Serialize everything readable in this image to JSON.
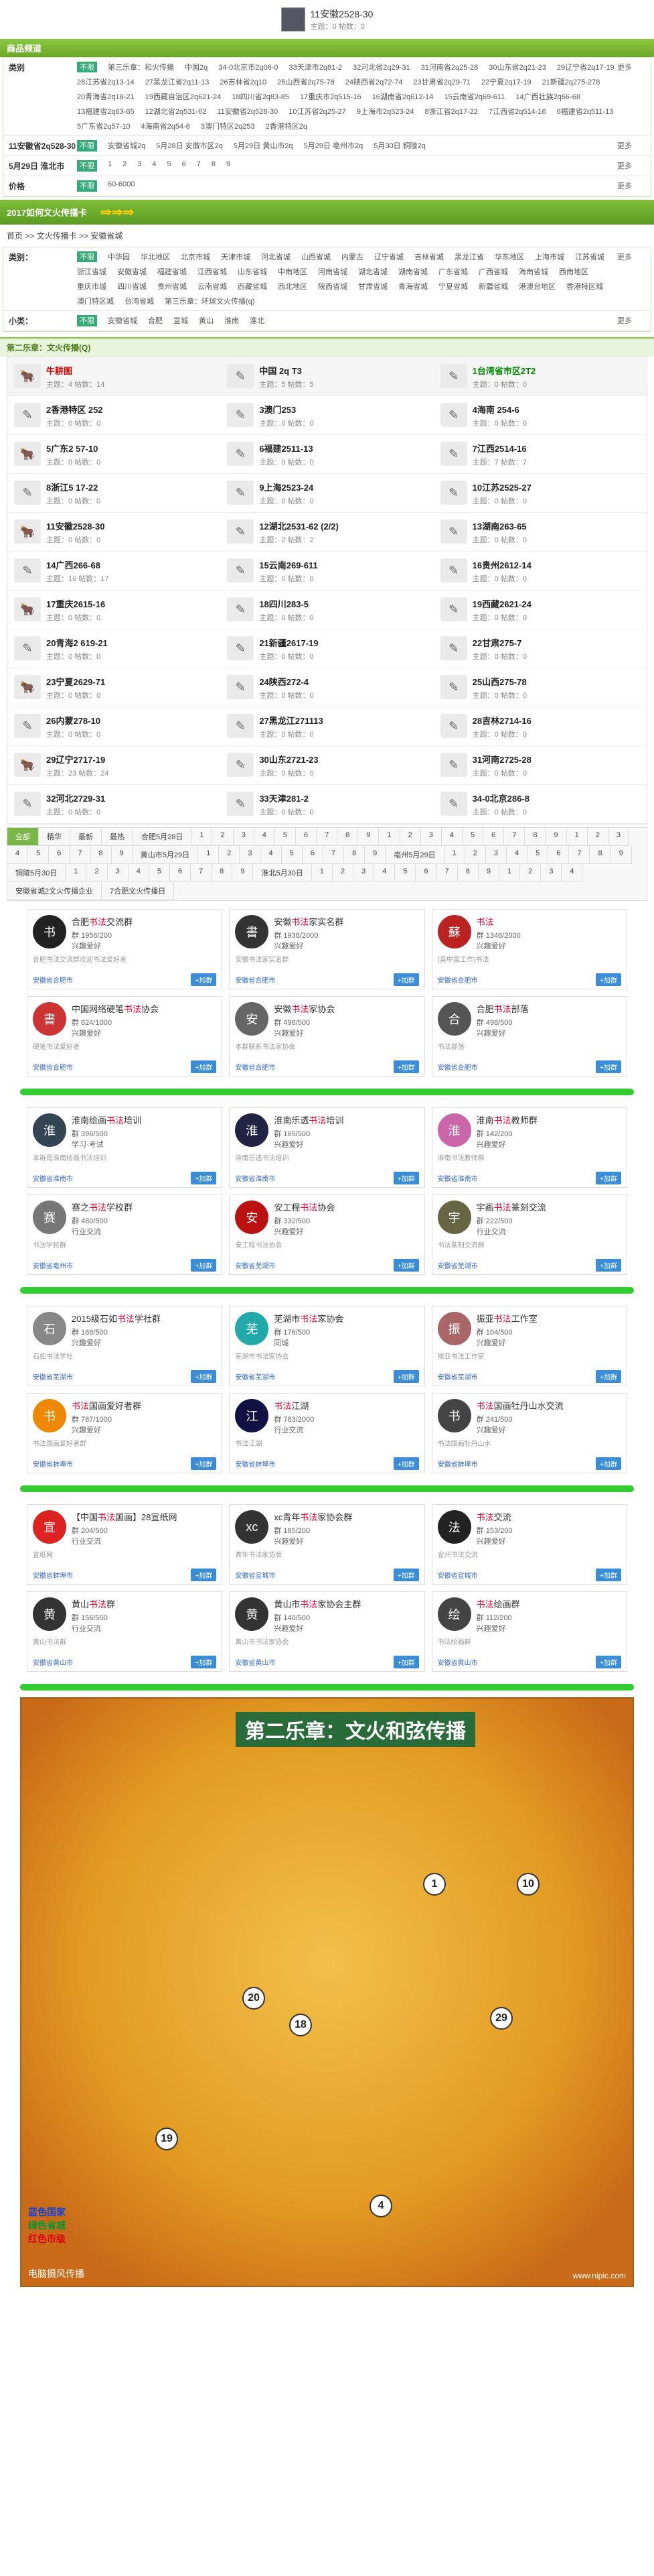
{
  "top": {
    "title": "11安徽2528-30",
    "sub": "主题：0 帖数：0"
  },
  "nav": {
    "title": "商品频道"
  },
  "filters": [
    {
      "label": "类别",
      "opts": [
        "不限",
        "第三乐章：和火传播",
        "中国2q",
        "34-0北京市2q06-0",
        "33天津市2q81-2",
        "32河北省2q29-31",
        "31河南省2q25-28",
        "30山东省2q21-23",
        "29辽宁省2q17-19",
        "28江苏省2q13-14",
        "27黑龙江省2q11-13",
        "26吉林省2q10",
        "25山西省2q75-78",
        "24陕西省2q72-74",
        "23甘肃省2q29-71",
        "22宁夏2q17-19",
        "21新疆2q275-278",
        "20青海省2q18-21",
        "19西藏自治区2q621-24",
        "18四川省2q83-85",
        "17重庆市2q515-16",
        "16湖南省2q612-14",
        "15云南省2q69-611",
        "14广西壮族2q66-68",
        "13福建省2q63-65",
        "12湖北省2q531-62",
        "11安徽省2q528-30",
        "10江苏省2q25-27",
        "9上海市2q523-24",
        "8浙江省2q17-22",
        "7江西省2q514-16",
        "6福建省2q511-13",
        "5广东省2q57-10",
        "4海南省2q54-6",
        "3澳门特区2q253",
        "2香港特区2q"
      ],
      "more": "更多"
    },
    {
      "label": "11安徽省2q528-30",
      "opts": [
        "不限",
        "安徽省城2q",
        "5月28日 安徽市区2q",
        "5月29日 黄山市2q",
        "5月29日 亳州市2q",
        "5月30日 铜陵2q"
      ],
      "more": "更多"
    },
    {
      "label": "5月29日 淮北市",
      "opts": [
        "不限",
        "1",
        "2",
        "3",
        "4",
        "5",
        "6",
        "7",
        "8",
        "9"
      ],
      "more": "更多"
    },
    {
      "label": "价格",
      "opts": [
        "不限",
        "60-6000"
      ],
      "more": "更多"
    }
  ],
  "crumbbar": {
    "title": "2017如何文火传播卡",
    "arrow": "⇒⇒⇒"
  },
  "crumb": [
    "首页",
    "文火传播卡",
    "安徽省城"
  ],
  "region": {
    "label": "类别：",
    "opts": [
      "不限",
      "中华园",
      "华北地区",
      "北京市城",
      "天津市城",
      "河北省城",
      "山西省城",
      "内蒙古",
      "辽宁省城",
      "吉林省城",
      "黑龙江省",
      "华东地区",
      "上海市城",
      "江苏省城",
      "浙江省城",
      "安徽省城",
      "福建省城",
      "江西省城",
      "山东省城",
      "中南地区",
      "河南省城",
      "湖北省城",
      "湖南省城",
      "广东省城",
      "广西省城",
      "海南省城",
      "西南地区",
      "重庆市城",
      "四川省城",
      "贵州省城",
      "云南省城",
      "西藏省城",
      "西北地区",
      "陕西省城",
      "甘肃省城",
      "青海省城",
      "宁夏省城",
      "新疆省城",
      "港澳台地区",
      "香港特区城",
      "澳门特区城",
      "台湾省城",
      "第三乐章：环球文火传播(q)"
    ],
    "more": "更多"
  },
  "subclass": {
    "label": "小类：",
    "opts": [
      "不限",
      "安徽省城",
      "合肥",
      "宣城",
      "黄山",
      "淮南",
      "淮北"
    ],
    "more": "更多"
  },
  "forum": {
    "head": "第二乐章：文火传播(Q)",
    "items": [
      {
        "name": "牛耕图",
        "meta": "主题：4 帖数：14",
        "hl": true,
        "cls": "red"
      },
      {
        "name": "中国 2q T3",
        "meta": "主题：5 帖数：5",
        "hl": true,
        "cls": ""
      },
      {
        "name": "1台湾省市区2T2",
        "meta": "主题：0 帖数：0",
        "hl": true,
        "cls": "gr"
      },
      {
        "name": "2香港特区 252",
        "meta": "主题：0 帖数：0",
        "cls": ""
      },
      {
        "name": "3澳门253",
        "meta": "主题：0 帖数：0",
        "cls": ""
      },
      {
        "name": "4海南 254-6",
        "meta": "主题：0 帖数：0",
        "cls": ""
      },
      {
        "name": "5广东2 57-10",
        "meta": "主题：0 帖数：0",
        "cls": ""
      },
      {
        "name": "6福建2511-13",
        "meta": "主题：0 帖数：0",
        "cls": ""
      },
      {
        "name": "7江西2514-16",
        "meta": "主题：7 帖数：7",
        "cls": ""
      },
      {
        "name": "8浙江5 17-22",
        "meta": "主题：0 帖数：0",
        "cls": ""
      },
      {
        "name": "9上海2523-24",
        "meta": "主题：0 帖数：0",
        "cls": ""
      },
      {
        "name": "10江苏2525-27",
        "meta": "主题：0 帖数：0",
        "cls": ""
      },
      {
        "name": "11安徽2528-30",
        "meta": "主题：0 帖数：0",
        "cls": ""
      },
      {
        "name": "12湖北2531-62 (2/2)",
        "meta": "主题：2 帖数：2",
        "cls": ""
      },
      {
        "name": "13湖南263-65",
        "meta": "主题：0 帖数：0",
        "cls": ""
      },
      {
        "name": "14广西266-68",
        "meta": "主题：16 帖数：17",
        "cls": ""
      },
      {
        "name": "15云南269-611",
        "meta": "主题：0 帖数：0",
        "cls": ""
      },
      {
        "name": "16贵州2612-14",
        "meta": "主题：0 帖数：0",
        "cls": ""
      },
      {
        "name": "17重庆2615-16",
        "meta": "主题：0 帖数：0",
        "cls": ""
      },
      {
        "name": "18四川283-5",
        "meta": "主题：0 帖数：0",
        "cls": ""
      },
      {
        "name": "19西藏2621-24",
        "meta": "主题：0 帖数：0",
        "cls": ""
      },
      {
        "name": "20青海2 619-21",
        "meta": "主题：0 帖数：0",
        "cls": ""
      },
      {
        "name": "21新疆2617-19",
        "meta": "主题：0 帖数：0",
        "cls": ""
      },
      {
        "name": "22甘肃275-7",
        "meta": "主题：0 帖数：0",
        "cls": ""
      },
      {
        "name": "23宁夏2629-71",
        "meta": "主题：0 帖数：0",
        "cls": ""
      },
      {
        "name": "24陕西272-4",
        "meta": "主题：0 帖数：0",
        "cls": ""
      },
      {
        "name": "25山西275-78",
        "meta": "主题：0 帖数：0",
        "cls": ""
      },
      {
        "name": "26内蒙278-10",
        "meta": "主题：0 帖数：0",
        "cls": ""
      },
      {
        "name": "27黑龙江271113",
        "meta": "主题：0 帖数：0",
        "cls": ""
      },
      {
        "name": "28吉林2714-16",
        "meta": "主题：0 帖数：0",
        "cls": ""
      },
      {
        "name": "29辽宁2717-19",
        "meta": "主题：23 帖数：24",
        "cls": ""
      },
      {
        "name": "30山东2721-23",
        "meta": "主题：0 帖数：0",
        "cls": ""
      },
      {
        "name": "31河南2725-28",
        "meta": "主题：0 帖数：0",
        "cls": ""
      },
      {
        "name": "32河北2729-31",
        "meta": "主题：0 帖数：0",
        "cls": ""
      },
      {
        "name": "33天津281-2",
        "meta": "主题：0 帖数：0",
        "cls": ""
      },
      {
        "name": "34-0北京286-8",
        "meta": "主题：0 帖数：0",
        "cls": ""
      }
    ]
  },
  "tags": [
    "全部",
    "精华",
    "最新",
    "最热",
    "合肥5月28日",
    "1",
    "2",
    "3",
    "4",
    "5",
    "6",
    "7",
    "8",
    "9",
    "1",
    "2",
    "3",
    "4",
    "5",
    "6",
    "7",
    "8",
    "9",
    "1",
    "2",
    "3",
    "4",
    "5",
    "6",
    "7",
    "8",
    "9",
    "黄山市5月29日",
    "1",
    "2",
    "3",
    "4",
    "5",
    "6",
    "7",
    "8",
    "9",
    "亳州5月29日",
    "1",
    "2",
    "3",
    "4",
    "5",
    "6",
    "7",
    "8",
    "9",
    "铜陵5月30日",
    "1",
    "2",
    "3",
    "4",
    "5",
    "6",
    "7",
    "8",
    "9",
    "淮北5月30日",
    "1",
    "2",
    "3",
    "4",
    "5",
    "6",
    "7",
    "8",
    "9",
    "1",
    "2",
    "3",
    "4",
    "安徽省城2文火传播企业",
    "7合肥文火传播日"
  ],
  "cards": [
    {
      "pre": "合肥",
      "hot": "书法",
      "post": "交流群",
      "num": "群 1956/200",
      "type": "兴趣爱好",
      "desc": "合肥书法交流群欢迎书法爱好者",
      "loc": "安徽省合肥市",
      "btn": "+加群",
      "av": "书"
    },
    {
      "pre": "安徽",
      "hot": "书法",
      "post": "家实名群",
      "num": "群 1938/2000",
      "type": "兴趣爱好",
      "desc": "安徽书法家实名群",
      "loc": "安徽省合肥市",
      "btn": "+加群",
      "av": "書"
    },
    {
      "pre": "",
      "hot": "书法",
      "post": "",
      "num": "群 1346/2000",
      "type": "兴趣爱好",
      "desc": "(英中富工作)书法",
      "loc": "安徽省合肥市",
      "btn": "+加群",
      "av": "蘇"
    },
    {
      "pre": "中国网络硬笔",
      "hot": "书法",
      "post": "协会",
      "num": "群 824/1000",
      "type": "兴趣爱好",
      "desc": "硬笔书法爱好者",
      "loc": "安徽省合肥市",
      "btn": "+加群",
      "av": "書"
    },
    {
      "pre": "安徽",
      "hot": "书法",
      "post": "家协会",
      "num": "群 496/500",
      "type": "兴趣爱好",
      "desc": "本群联系书法家协会",
      "loc": "安徽省合肥市",
      "btn": "+加群",
      "av": "安"
    },
    {
      "pre": "合肥",
      "hot": "书法",
      "post": "部落",
      "num": "群 498/500",
      "type": "兴趣爱好",
      "desc": "书法部落",
      "loc": "安徽省合肥市",
      "btn": "+加群",
      "av": "合"
    },
    {
      "pre": "淮南绘画",
      "hot": "书法",
      "post": "培训",
      "num": "群 396/500",
      "type": "学习·考试",
      "desc": "本群是淮南绘画书法培训",
      "loc": "安徽省淮南市",
      "btn": "+加群",
      "av": "淮"
    },
    {
      "pre": "淮南乐透",
      "hot": "书法",
      "post": "培训",
      "num": "群 165/500",
      "type": "兴趣爱好",
      "desc": "淮南乐透书法培训",
      "loc": "安徽省淮南市",
      "btn": "+加群",
      "av": "淮"
    },
    {
      "pre": "淮南",
      "hot": "书法",
      "post": "教师群",
      "num": "群 142/200",
      "type": "兴趣爱好",
      "desc": "淮南书法教师群",
      "loc": "安徽省淮南市",
      "btn": "+加群",
      "av": "淮"
    },
    {
      "pre": "赛之",
      "hot": "书法",
      "post": "学校群",
      "num": "群 480/500",
      "type": "行业交流",
      "desc": "书法学校群",
      "loc": "安徽省亳州市",
      "btn": "+加群",
      "av": "赛"
    },
    {
      "pre": "安工程",
      "hot": "书法",
      "post": "协会",
      "num": "群 332/500",
      "type": "兴趣爱好",
      "desc": "安工程书法协会",
      "loc": "安徽省芜湖市",
      "btn": "+加群",
      "av": "安"
    },
    {
      "pre": "宇画",
      "hot": "书法",
      "post": "篆刻交流",
      "num": "群 222/500",
      "type": "行业交流",
      "desc": "书法篆刻交流群",
      "loc": "安徽省芜湖市",
      "btn": "+加群",
      "av": "宇"
    },
    {
      "pre": "2015级石如",
      "hot": "书法",
      "post": "学社群",
      "num": "群 186/500",
      "type": "兴趣爱好",
      "desc": "石如书法学社",
      "loc": "安徽省芜湖市",
      "btn": "+加群",
      "av": "石"
    },
    {
      "pre": "芜湖市",
      "hot": "书法",
      "post": "家协会",
      "num": "群 176/500",
      "type": "同城",
      "desc": "芜湖市书法家协会",
      "loc": "安徽省芜湖市",
      "btn": "+加群",
      "av": "芜"
    },
    {
      "pre": "振亚",
      "hot": "书法",
      "post": "工作室",
      "num": "群 104/500",
      "type": "兴趣爱好",
      "desc": "振亚书法工作室",
      "loc": "安徽省芜湖市",
      "btn": "+加群",
      "av": "振"
    },
    {
      "pre": "",
      "hot": "书法",
      "post": "国画爱好者群",
      "num": "群 787/1000",
      "type": "兴趣爱好",
      "desc": "书法国画爱好者群",
      "loc": "安徽省蚌埠市",
      "btn": "+加群",
      "av": "书"
    },
    {
      "pre": "",
      "hot": "书法",
      "post": "江湖",
      "num": "群 783/2000",
      "type": "行业交流",
      "desc": "书法江湖",
      "loc": "安徽省蚌埠市",
      "btn": "+加群",
      "av": "江"
    },
    {
      "pre": "",
      "hot": "书法",
      "post": "国画牡丹山水交流",
      "num": "群 241/500",
      "type": "兴趣爱好",
      "desc": "书法国画牡丹山水",
      "loc": "安徽省蚌埠市",
      "btn": "+加群",
      "av": "书"
    },
    {
      "pre": "【中国",
      "hot": "书法",
      "post": "国画】28宣纸网",
      "num": "群 204/500",
      "type": "行业交流",
      "desc": "宣纸网",
      "loc": "安徽省蚌埠市",
      "btn": "+加群",
      "av": "宣"
    },
    {
      "pre": "xc青年",
      "hot": "书法",
      "post": "家协会群",
      "num": "群 185/200",
      "type": "兴趣爱好",
      "desc": "青年书法家协会",
      "loc": "安徽省宣城市",
      "btn": "+加群",
      "av": "xc"
    },
    {
      "pre": "",
      "hot": "书法",
      "post": "交流",
      "num": "群 153/200",
      "type": "兴趣爱好",
      "desc": "宣州书法交流",
      "loc": "安徽省宣城市",
      "btn": "+加群",
      "av": "法"
    },
    {
      "pre": "黄山",
      "hot": "书法",
      "post": "群",
      "num": "群 156/500",
      "type": "行业交流",
      "desc": "黄山书法群",
      "loc": "安徽省黄山市",
      "btn": "+加群",
      "av": "黄"
    },
    {
      "pre": "黄山市",
      "hot": "书法",
      "post": "家协会主群",
      "num": "群 140/500",
      "type": "兴趣爱好",
      "desc": "黄山市书法家协会",
      "loc": "安徽省黄山市",
      "btn": "+加群",
      "av": "黄"
    },
    {
      "pre": "",
      "hot": "书法",
      "post": "绘画群",
      "num": "群 112/200",
      "type": "兴趣爱好",
      "desc": "书法绘画群",
      "loc": "安徽省黄山市",
      "btn": "+加群",
      "av": "绘"
    }
  ],
  "map": {
    "title": "第二乐章：文火和弦传播",
    "legend": [
      "蓝色国家",
      "绿色省城",
      "红色市级"
    ],
    "wm": "电脑摄风传播",
    "wm2": "www.nipic.com",
    "pins": [
      "1",
      "18",
      "20",
      "19",
      "10",
      "29",
      "4"
    ]
  },
  "colors": {
    "accent": "#8cc63f",
    "link": "#3b8dd8",
    "hot": "#e00033"
  }
}
